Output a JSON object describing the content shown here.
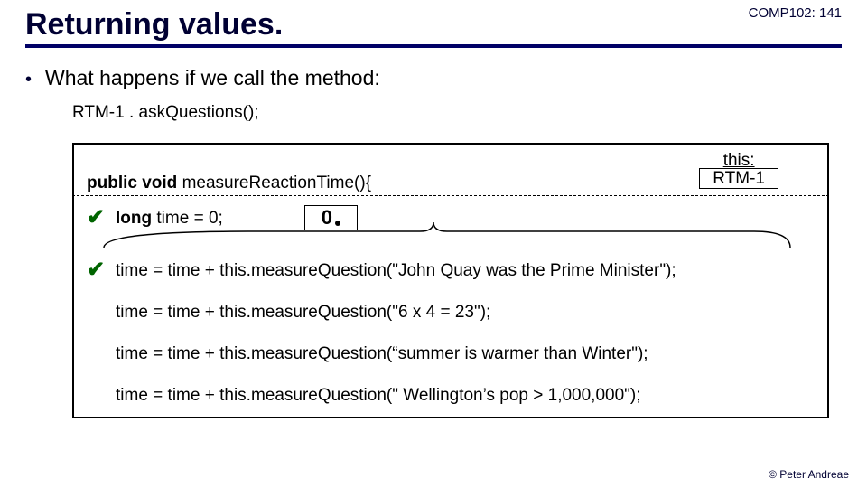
{
  "header": {
    "title": "Returning values.",
    "course_tag": "COMP102: 141"
  },
  "bullet": {
    "text": "What happens if we call the method:"
  },
  "subline": "RTM-1 . askQuestions();",
  "code": {
    "kw_public": "public",
    "kw_void": "void",
    "method_name": " measureReactionTime(){",
    "this_label": "this:",
    "this_value": "RTM-1",
    "kw_long": "long",
    "decl_rest": " time = 0;",
    "value_box": "0",
    "stmt1": "time = time + this.measureQuestion(\"John Quay was the Prime Minister\");",
    "stmt2": "time = time + this.measureQuestion(\"6 x 4 = 23\");",
    "stmt3": "time = time + this.measureQuestion(“summer is warmer than Winter\");",
    "stmt4": "time = time + this.measureQuestion(\" Wellington’s pop > 1,000,000\");"
  },
  "footer": "© Peter Andreae",
  "checks": {
    "mark": "✔"
  }
}
